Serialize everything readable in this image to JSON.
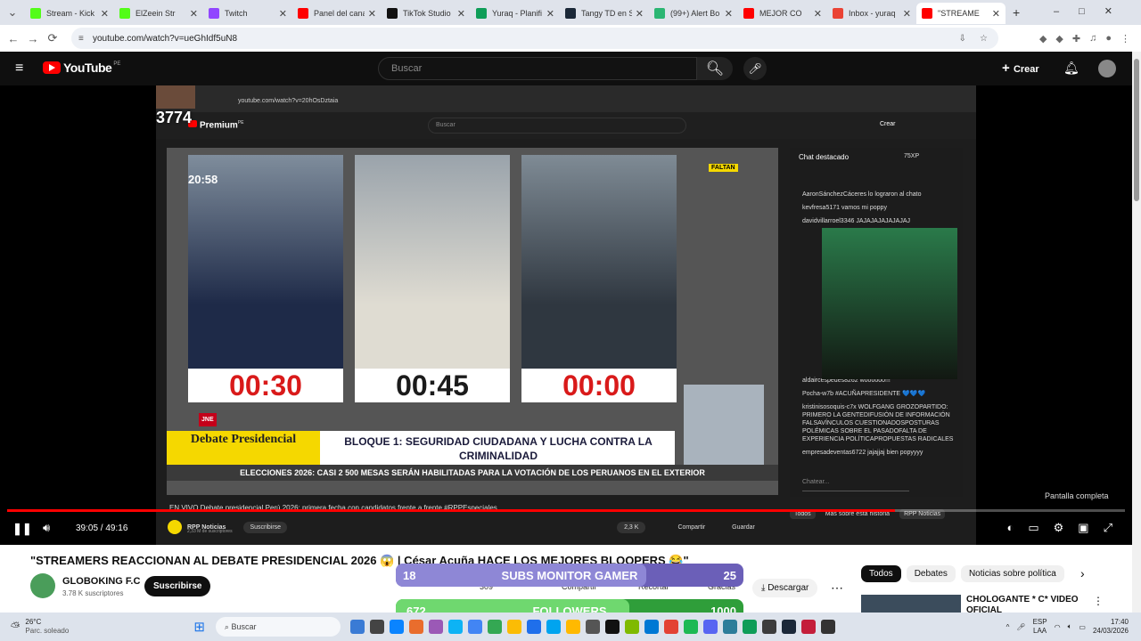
{
  "tabs": [
    {
      "title": "Stream - Kick",
      "color": "#53fc18"
    },
    {
      "title": "ElZeein Str",
      "color": "#53fc18"
    },
    {
      "title": "Twitch",
      "color": "#9146ff"
    },
    {
      "title": "Panel del cana",
      "color": "#ff0000"
    },
    {
      "title": "TikTok Studio",
      "color": "#111111"
    },
    {
      "title": "Yuraq - Planifi",
      "color": "#0f9d58"
    },
    {
      "title": "Tangy TD en St",
      "color": "#1b2838"
    },
    {
      "title": "(99+) Alert Bo",
      "color": "#2bb673"
    },
    {
      "title": "MEJOR CO",
      "color": "#ff0000"
    },
    {
      "title": "Inbox - yuraq",
      "color": "#ea4335"
    },
    {
      "title": "\"STREAME",
      "color": "#ff0000"
    }
  ],
  "url": "youtube.com/watch?v=ueGhIdf5uN8",
  "yt": {
    "logo": "YouTube",
    "region": "PE",
    "search_placeholder": "Buscar",
    "create": "Crear"
  },
  "video": {
    "inner_url": "youtube.com/watch?v=20hOsDztaia",
    "inner_logo": "Premium",
    "inner_region": "PE",
    "inner_search": "Buscar",
    "inner_create": "Crear",
    "overlay_number": "3774",
    "clock": "20:58",
    "timers": [
      "00:30",
      "00:45",
      "00:00"
    ],
    "faltan": "FALTAN",
    "banner_left": "Debate Presidencial",
    "banner_right": "BLOQUE 1: SEGURIDAD CIUDADANA Y LUCHA CONTRA LA CRIMINALIDAD",
    "ticker": "ELECCIONES 2026: CASI 2 500 MESAS SERÁN HABILITADAS PARA LA VOTACIÓN DE LOS PERUANOS EN EL EXTERIOR",
    "jne": "JNE",
    "live_title": "EN VIVO Debate presidencial Perú 2026: primera fecha con candidatos frente a frente #RPPEspeciales",
    "channel": "RPP Noticias",
    "subs": "2,33 M de suscriptores",
    "subscribe": "Suscribirse",
    "likes": "2,3 K",
    "share": "Compartir",
    "save": "Guardar",
    "fullscreen": "Pantalla completa",
    "time": "39:05 / 49:16",
    "chips": [
      "Todos",
      "Más sobre esta historia",
      "RPP Noticias"
    ]
  },
  "chat": {
    "title": "Chat destacado",
    "points": "75XP",
    "lines": [
      "AaronSánchezCáceres lo lograron al chato",
      "kevfresa5171 vamos mi poppy",
      "davidvillarroel3346 JAJAJAJAJAJAJAJ",
      "aldaircespedes8262 woooooo!!!",
      "Pocha-w7b #ACUÑAPRESIDENTE 💙💙💙",
      "kristinisosoquis-c7x WOLFGANG GROZOPARTIDO: PRIMERO LA GENTEDIFUSIÓN DE INFORMACIÓN FALSAVÍNCULOS CUESTIONADOSPOSTURAS POLÉMICAS SOBRE EL PASADOFALTA DE EXPERIENCIA POLÍTICAPROPUESTAS RADICALES",
      "empresadeventas6722 jajajjaj bien popyyyy"
    ],
    "input": "Chatear..."
  },
  "page": {
    "title": "\"STREAMERS REACCIONAN AL DEBATE PRESIDENCIAL 2026 😱 | César Acuña HACE LOS MEJORES BLOOPERS 😂\"",
    "channel": "GLOBOKING F.C",
    "subs": "3.78 K suscriptores",
    "subscribe": "Suscribirse",
    "likes": "309",
    "share": "Compartir",
    "clip": "Recortar",
    "thanks": "Gracias",
    "download": "Descargar",
    "chips": [
      "Todos",
      "Debates",
      "Noticias sobre política",
      "V"
    ],
    "side_title": "CHOLOGANTE * C* VIDEO OFICIAL"
  },
  "overlays": {
    "subs": {
      "left": "18",
      "label": "SUBS MONITOR GAMER",
      "right": "25",
      "fill": 0.72
    },
    "followers": {
      "left": "672",
      "label": "FOLLOWERS",
      "right": "1000",
      "fill": 0.672
    }
  },
  "taskbar": {
    "weather_temp": "26°C",
    "weather_desc": "Parc. soleado",
    "search": "Buscar",
    "lang1": "ESP",
    "lang2": "LAA",
    "time": "17:40",
    "date": "24/03/2026"
  }
}
